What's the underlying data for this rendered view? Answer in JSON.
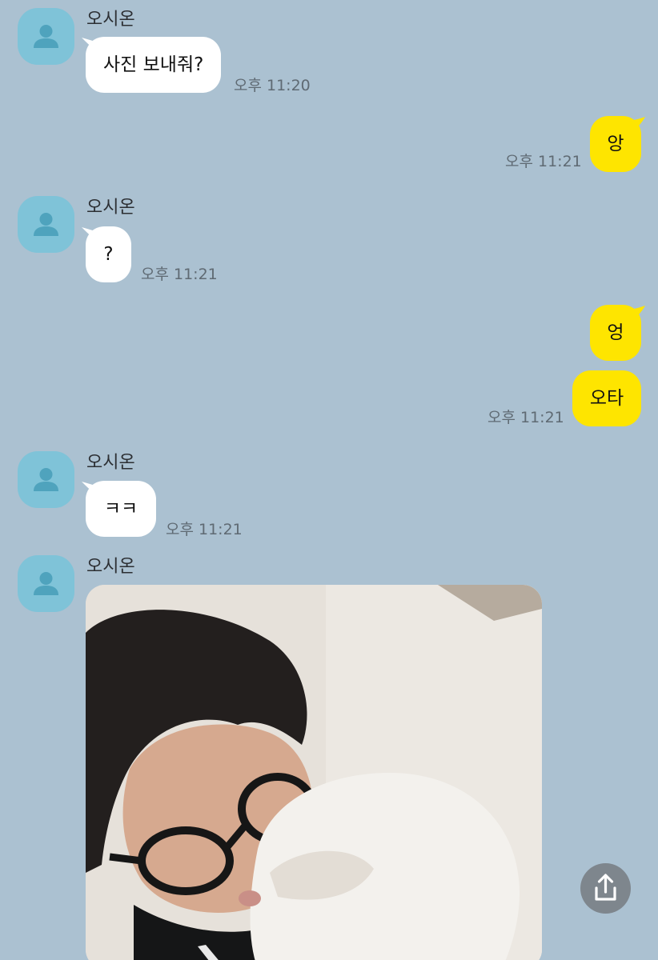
{
  "chat": {
    "contact_name": "오시온",
    "messages": [
      {
        "from": "them",
        "text": "사진 보내줘?",
        "time": "오후 11:20"
      },
      {
        "from": "me",
        "text": "앙",
        "time": "오후 11:21"
      },
      {
        "from": "them",
        "text": "?",
        "time": "오후 11:21"
      },
      {
        "from": "me",
        "text": "엉",
        "time": ""
      },
      {
        "from": "me",
        "text": "오타",
        "time": "오후 11:21"
      },
      {
        "from": "them",
        "text": "ㅋㅋ",
        "time": "오후 11:21"
      },
      {
        "from": "them",
        "type": "photo",
        "photo_icon": "photo-image"
      }
    ]
  },
  "icons": {
    "avatar": "person-icon",
    "share": "share-upload-icon"
  },
  "colors": {
    "background": "#abc1d1",
    "incoming_bubble": "#ffffff",
    "outgoing_bubble": "#fee500",
    "avatar": "#7fc3d8",
    "share_button": "#7e868d"
  }
}
